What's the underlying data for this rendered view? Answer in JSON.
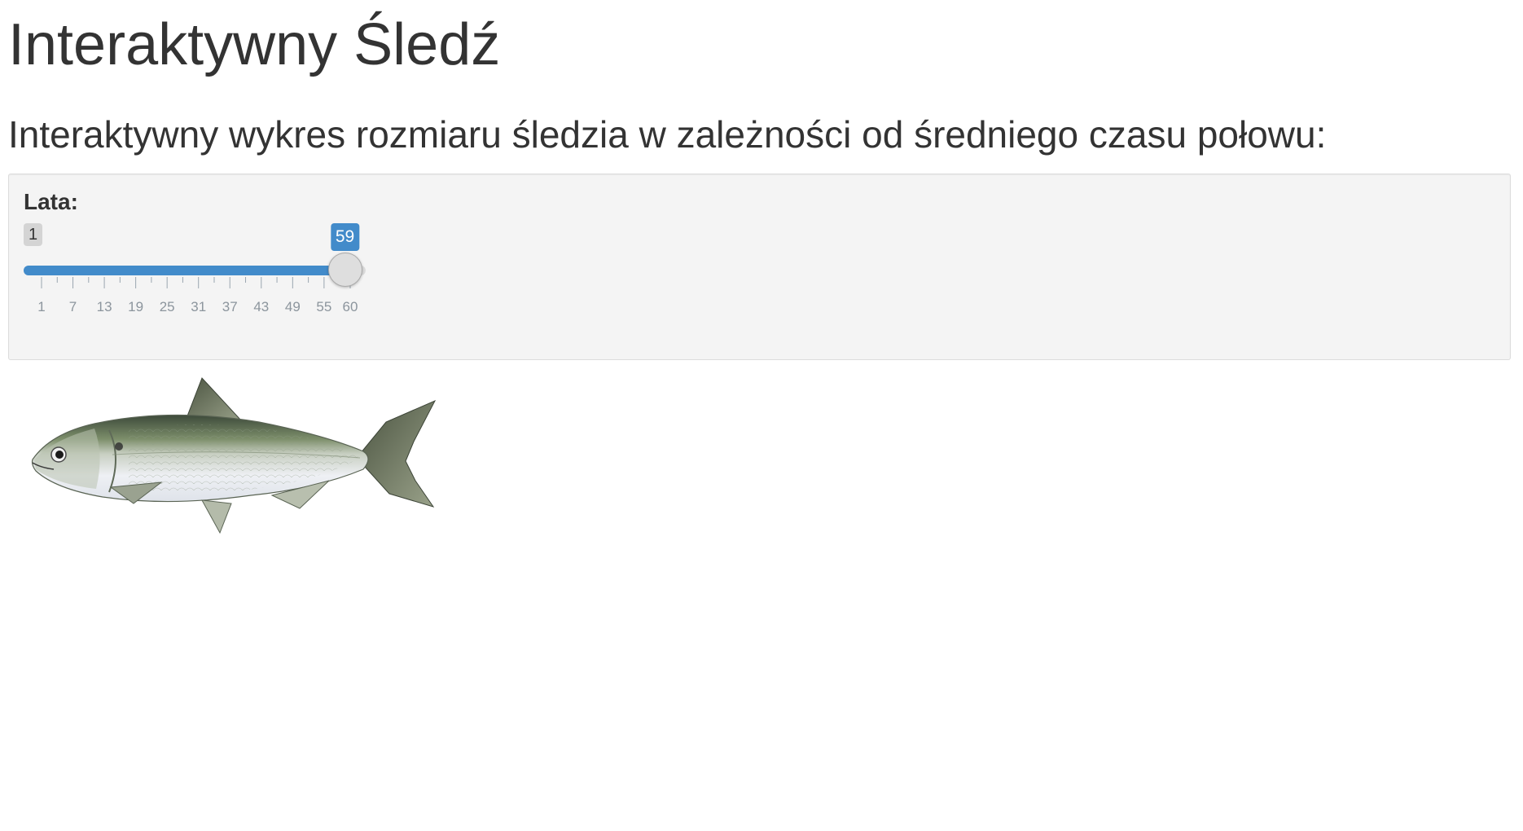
{
  "page": {
    "title": "Interaktywny Śledź",
    "subtitle": "Interaktywny wykres rozmiaru śledzia w zależności od średniego czasu połowu:"
  },
  "controls": {
    "slider": {
      "label": "Lata:",
      "min": 1,
      "max": 60,
      "value": 59,
      "min_badge": "1",
      "value_badge": "59",
      "tick_labels": [
        "1",
        "7",
        "13",
        "19",
        "25",
        "31",
        "37",
        "43",
        "49",
        "55",
        "60"
      ],
      "accent_color": "#428bca"
    }
  },
  "image": {
    "subject": "herring-fish"
  }
}
